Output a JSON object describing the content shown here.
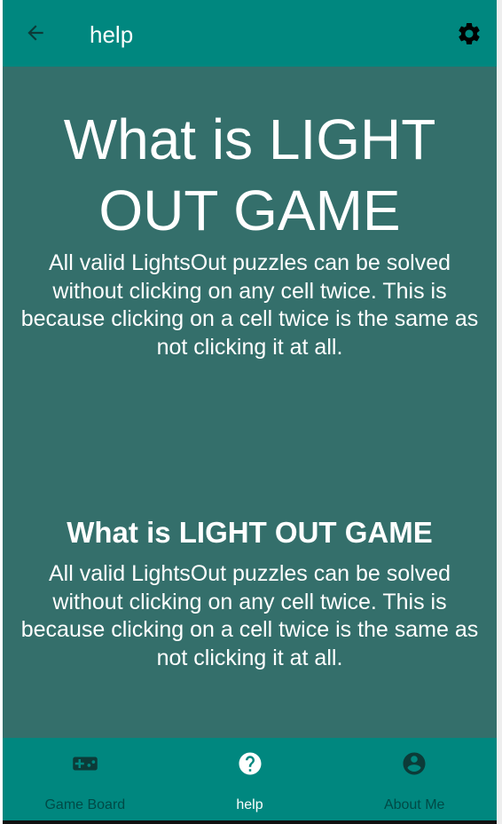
{
  "app_bar": {
    "title": "help"
  },
  "content": {
    "big_title": "What is LIGHT OUT GAME",
    "paragraph_1": "All valid LightsOut puzzles can be solved without clicking on any cell twice. This is because clicking on a cell twice is the same as not clicking it at all.",
    "mid_title": "What is LIGHT OUT GAME",
    "paragraph_2": "All valid LightsOut puzzles can be solved without clicking on any cell twice. This is because clicking on a cell twice is the same as not clicking it at all."
  },
  "bottom_nav": {
    "items": [
      {
        "label": "Game Board",
        "icon": "gamepad-icon",
        "active": false
      },
      {
        "label": "help",
        "icon": "help-circle-icon",
        "active": true
      },
      {
        "label": "About Me",
        "icon": "account-circle-icon",
        "active": false
      }
    ]
  },
  "colors": {
    "app_bar": "#00877f",
    "content_background": "#346f6b",
    "bottom_nav": "#00877f",
    "inactive_nav": "#004a46",
    "active_nav": "#ffffff"
  }
}
